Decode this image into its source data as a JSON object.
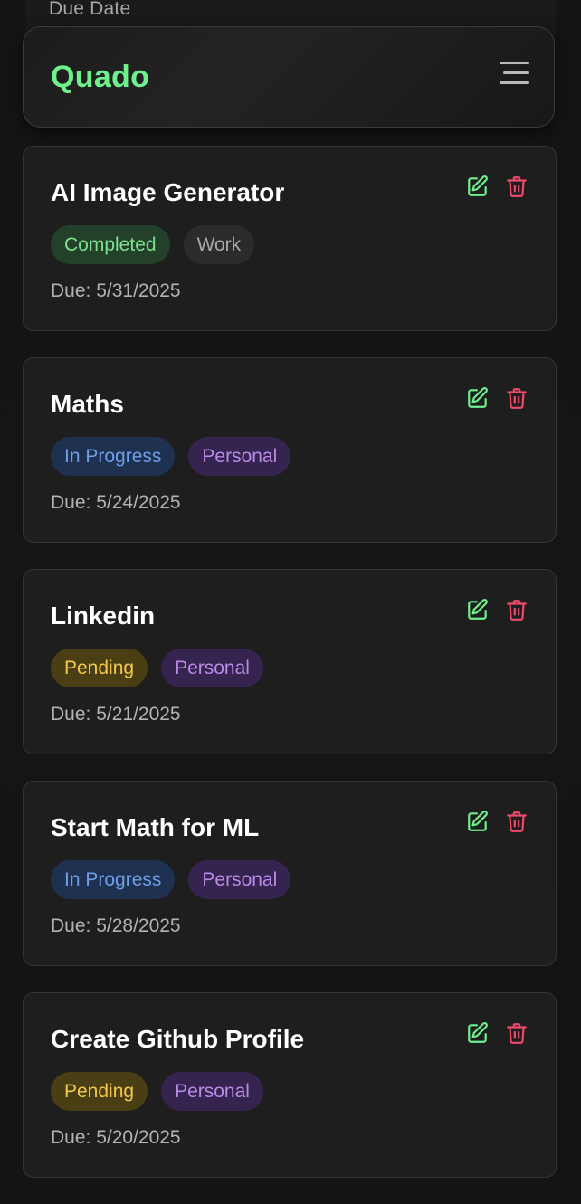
{
  "filter": {
    "label": "Due Date"
  },
  "header": {
    "brand": "Quado",
    "menu_icon": "hamburger-menu-icon"
  },
  "colors": {
    "brand": "#6ef08c",
    "edit": "#6ef08c",
    "delete": "#ef4a6a"
  },
  "status_styles": {
    "Completed": {
      "bg": "#23402a",
      "fg": "#7ee08e"
    },
    "In Progress": {
      "bg": "#1f3150",
      "fg": "#6f9ee6"
    },
    "Pending": {
      "bg": "#4a3e14",
      "fg": "#f2c94c"
    }
  },
  "category_styles": {
    "Work": {
      "bg": "#2b2b2e",
      "fg": "#a9a9a9"
    },
    "Personal": {
      "bg": "#35244f",
      "fg": "#b98ae8"
    }
  },
  "tasks": [
    {
      "title": "AI Image Generator",
      "status": "Completed",
      "category": "Work",
      "due": "Due: 5/31/2025"
    },
    {
      "title": "Maths",
      "status": "In Progress",
      "category": "Personal",
      "due": "Due: 5/24/2025"
    },
    {
      "title": "Linkedin",
      "status": "Pending",
      "category": "Personal",
      "due": "Due: 5/21/2025"
    },
    {
      "title": "Start Math for ML",
      "status": "In Progress",
      "category": "Personal",
      "due": "Due: 5/28/2025"
    },
    {
      "title": "Create Github Profile",
      "status": "Pending",
      "category": "Personal",
      "due": "Due: 5/20/2025"
    }
  ],
  "icons": {
    "edit": "edit-icon",
    "delete": "trash-icon"
  }
}
